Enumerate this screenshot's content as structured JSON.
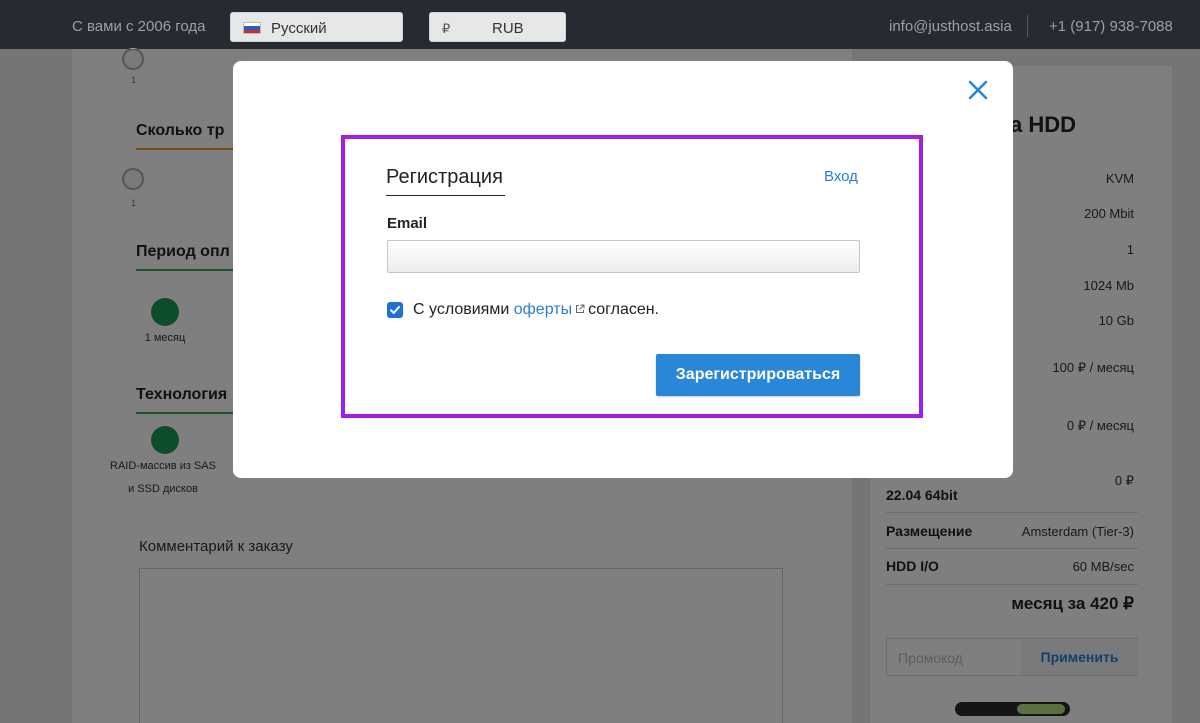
{
  "topbar": {
    "since": "С вами с 2006 года",
    "language": "Русский",
    "currency_sign": "₽",
    "currency": "RUB",
    "email": "info@justhost.asia",
    "phone": "+1 (917) 938-7088"
  },
  "config": {
    "traffic_title": "Сколько тр",
    "period_title": "Период опл",
    "period_option": "1 месяц",
    "tech_title": "Технология",
    "tech_option_line1": "RAID-массив из SAS",
    "tech_option_line2": "и SSD дисков",
    "slider_tick": "1",
    "comment_label": "Комментарий к заказу"
  },
  "summary": {
    "title_fragment": "а HDD",
    "values": [
      "KVM",
      "200 Mbit",
      "1",
      "1024 Mb",
      "10 Gb",
      "100 ₽ / месяц",
      "0 ₽ / месяц",
      "0 ₽"
    ],
    "os_fragment": "22.04 64bit",
    "placement_label": "Размещение",
    "placement_value": "Amsterdam (Tier-3)",
    "hdd_io_label": "HDD I/O",
    "hdd_io_value": "60 MB/sec",
    "total": "месяц за 420 ₽",
    "promo_placeholder": "Промокод",
    "apply_label": "Применить"
  },
  "modal": {
    "tab_register": "Регистрация",
    "tab_login": "Вход",
    "email_label": "Email",
    "email_value": "",
    "terms_prefix": "С условиями",
    "terms_link": "оферты",
    "terms_suffix": "согласен.",
    "terms_checked": true,
    "submit_label": "Зарегистрироваться"
  },
  "colors": {
    "accent": "#2a86d6",
    "highlight": "#a21ee0",
    "green": "#1a9a52"
  }
}
